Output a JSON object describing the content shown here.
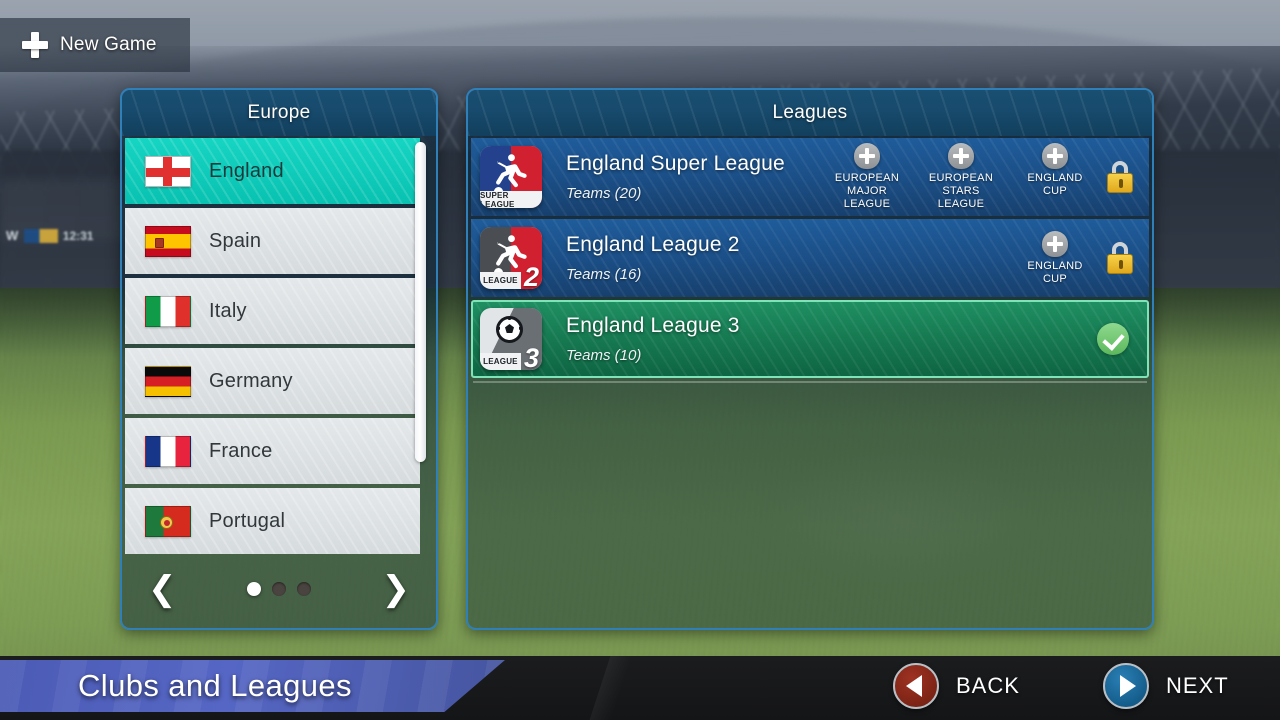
{
  "topbar": {
    "new_game_label": "New Game",
    "plus_icon": "plus-icon"
  },
  "left_panel": {
    "title": "Europe",
    "countries": [
      {
        "name": "England",
        "flag": "flag-england",
        "selected": true
      },
      {
        "name": "Spain",
        "flag": "flag-spain",
        "selected": false
      },
      {
        "name": "Italy",
        "flag": "flag-italy",
        "selected": false
      },
      {
        "name": "Germany",
        "flag": "flag-germany",
        "selected": false
      },
      {
        "name": "France",
        "flag": "flag-france",
        "selected": false
      },
      {
        "name": "Portugal",
        "flag": "flag-portugal",
        "selected": false
      }
    ],
    "pager": {
      "prev_icon": "chevron-left-icon",
      "next_icon": "chevron-right-icon",
      "prev_glyph": "❮",
      "next_glyph": "❯",
      "page_count": 3,
      "active_page": 1
    }
  },
  "right_panel": {
    "title": "Leagues",
    "leagues": [
      {
        "name": "England Super League",
        "teams": "Teams (20)",
        "badge_caption": "SUPER LEAGUE",
        "badge_number": "",
        "selected": false,
        "locked": true,
        "cups": [
          {
            "label": "EUROPEAN MAJOR LEAGUE"
          },
          {
            "label": "EUROPEAN STARS LEAGUE"
          },
          {
            "label": "ENGLAND CUP"
          }
        ]
      },
      {
        "name": "England League 2",
        "teams": "Teams (16)",
        "badge_caption": "LEAGUE",
        "badge_number": "2",
        "selected": false,
        "locked": true,
        "cups": [
          {
            "label": "ENGLAND CUP"
          }
        ]
      },
      {
        "name": "England League 3",
        "teams": "Teams (10)",
        "badge_caption": "LEAGUE",
        "badge_number": "3",
        "selected": true,
        "locked": false,
        "cups": []
      }
    ]
  },
  "bottom": {
    "screen_title": "Clubs and Leagues",
    "back_label": "BACK",
    "next_label": "NEXT"
  },
  "background": {
    "scoreboard_team": "W",
    "scoreboard_time": "12:31"
  },
  "colors": {
    "accent_teal": "#09c2b1",
    "panel_border": "#2f7fb8",
    "header_blue": "#174a6c",
    "row_blue": "#1b4f87",
    "selected_green": "#15774f",
    "check_green": "#5cb85c",
    "lock_yellow": "#e0a81c",
    "banner_purple": "#5566c4",
    "back_red": "#7a2315",
    "next_blue": "#135b88"
  }
}
